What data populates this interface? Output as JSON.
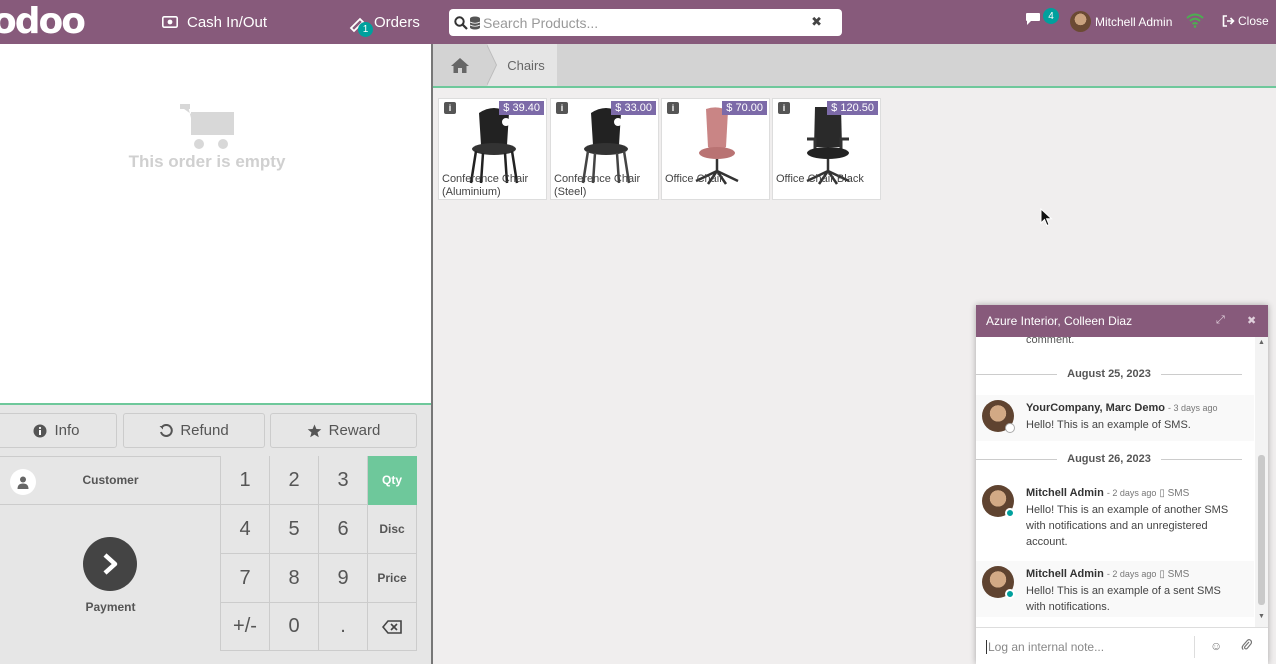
{
  "app": {
    "logo": "odoo"
  },
  "topbar": {
    "cash_label": "Cash In/Out",
    "orders_label": "Orders",
    "orders_badge": "1",
    "search_placeholder": "Search Products...",
    "search_clear": "✖",
    "chat_badge": "4",
    "user_name": "Mitchell Admin",
    "close_label": "Close"
  },
  "order": {
    "empty_text": "This order is empty"
  },
  "controls": {
    "info_label": "Info",
    "refund_label": "Refund",
    "reward_label": "Reward",
    "customer_label": "Customer",
    "payment_label": "Payment"
  },
  "numpad": {
    "keys": [
      "1",
      "2",
      "3",
      "Qty",
      "4",
      "5",
      "6",
      "Disc",
      "7",
      "8",
      "9",
      "Price",
      "+/-",
      "0",
      ".",
      ""
    ],
    "active_mode": "Qty"
  },
  "breadcrumb": {
    "category": "Chairs"
  },
  "products": [
    {
      "name": "Conference Chair (Aluminium)",
      "price": "$ 39.40"
    },
    {
      "name": "Conference Chair (Steel)",
      "price": "$ 33.00"
    },
    {
      "name": "Office Chair",
      "price": "$ 70.00"
    },
    {
      "name": "Office Chair Black",
      "price": "$ 120.50"
    }
  ],
  "chat": {
    "title": "Azure Interior, Colleen Diaz",
    "prev_text": "comment.",
    "date1": "August 25, 2023",
    "date2": "August 26, 2023",
    "messages": [
      {
        "author": "YourCompany, Marc Demo",
        "meta": "- 3 days ago",
        "channel": "",
        "text": "Hello! This is an example of SMS."
      },
      {
        "author": "Mitchell Admin",
        "meta": "- 2 days ago",
        "channel": "▯ SMS",
        "text": "Hello! This is an example of another SMS with notifications and an unregistered account."
      },
      {
        "author": "Mitchell Admin",
        "meta": "- 2 days ago",
        "channel": "▯ SMS",
        "text": "Hello! This is an example of a sent SMS with notifications."
      }
    ],
    "composer_placeholder": "Log an internal note..."
  },
  "colors": {
    "brand": "#875a7b",
    "accent": "#6ec89b",
    "price_badge": "#7c6aa8",
    "badge": "#00a09d"
  },
  "icons": [
    "money-icon",
    "ticket-icon",
    "search-icon",
    "database-icon",
    "chat-icon",
    "wifi-icon",
    "sign-out-icon",
    "cart-icon",
    "info-icon",
    "undo-icon",
    "star-icon",
    "user-icon",
    "chevron-right-icon",
    "backspace-icon",
    "home-icon",
    "expand-icon",
    "close-icon",
    "emoji-icon",
    "paperclip-icon"
  ]
}
